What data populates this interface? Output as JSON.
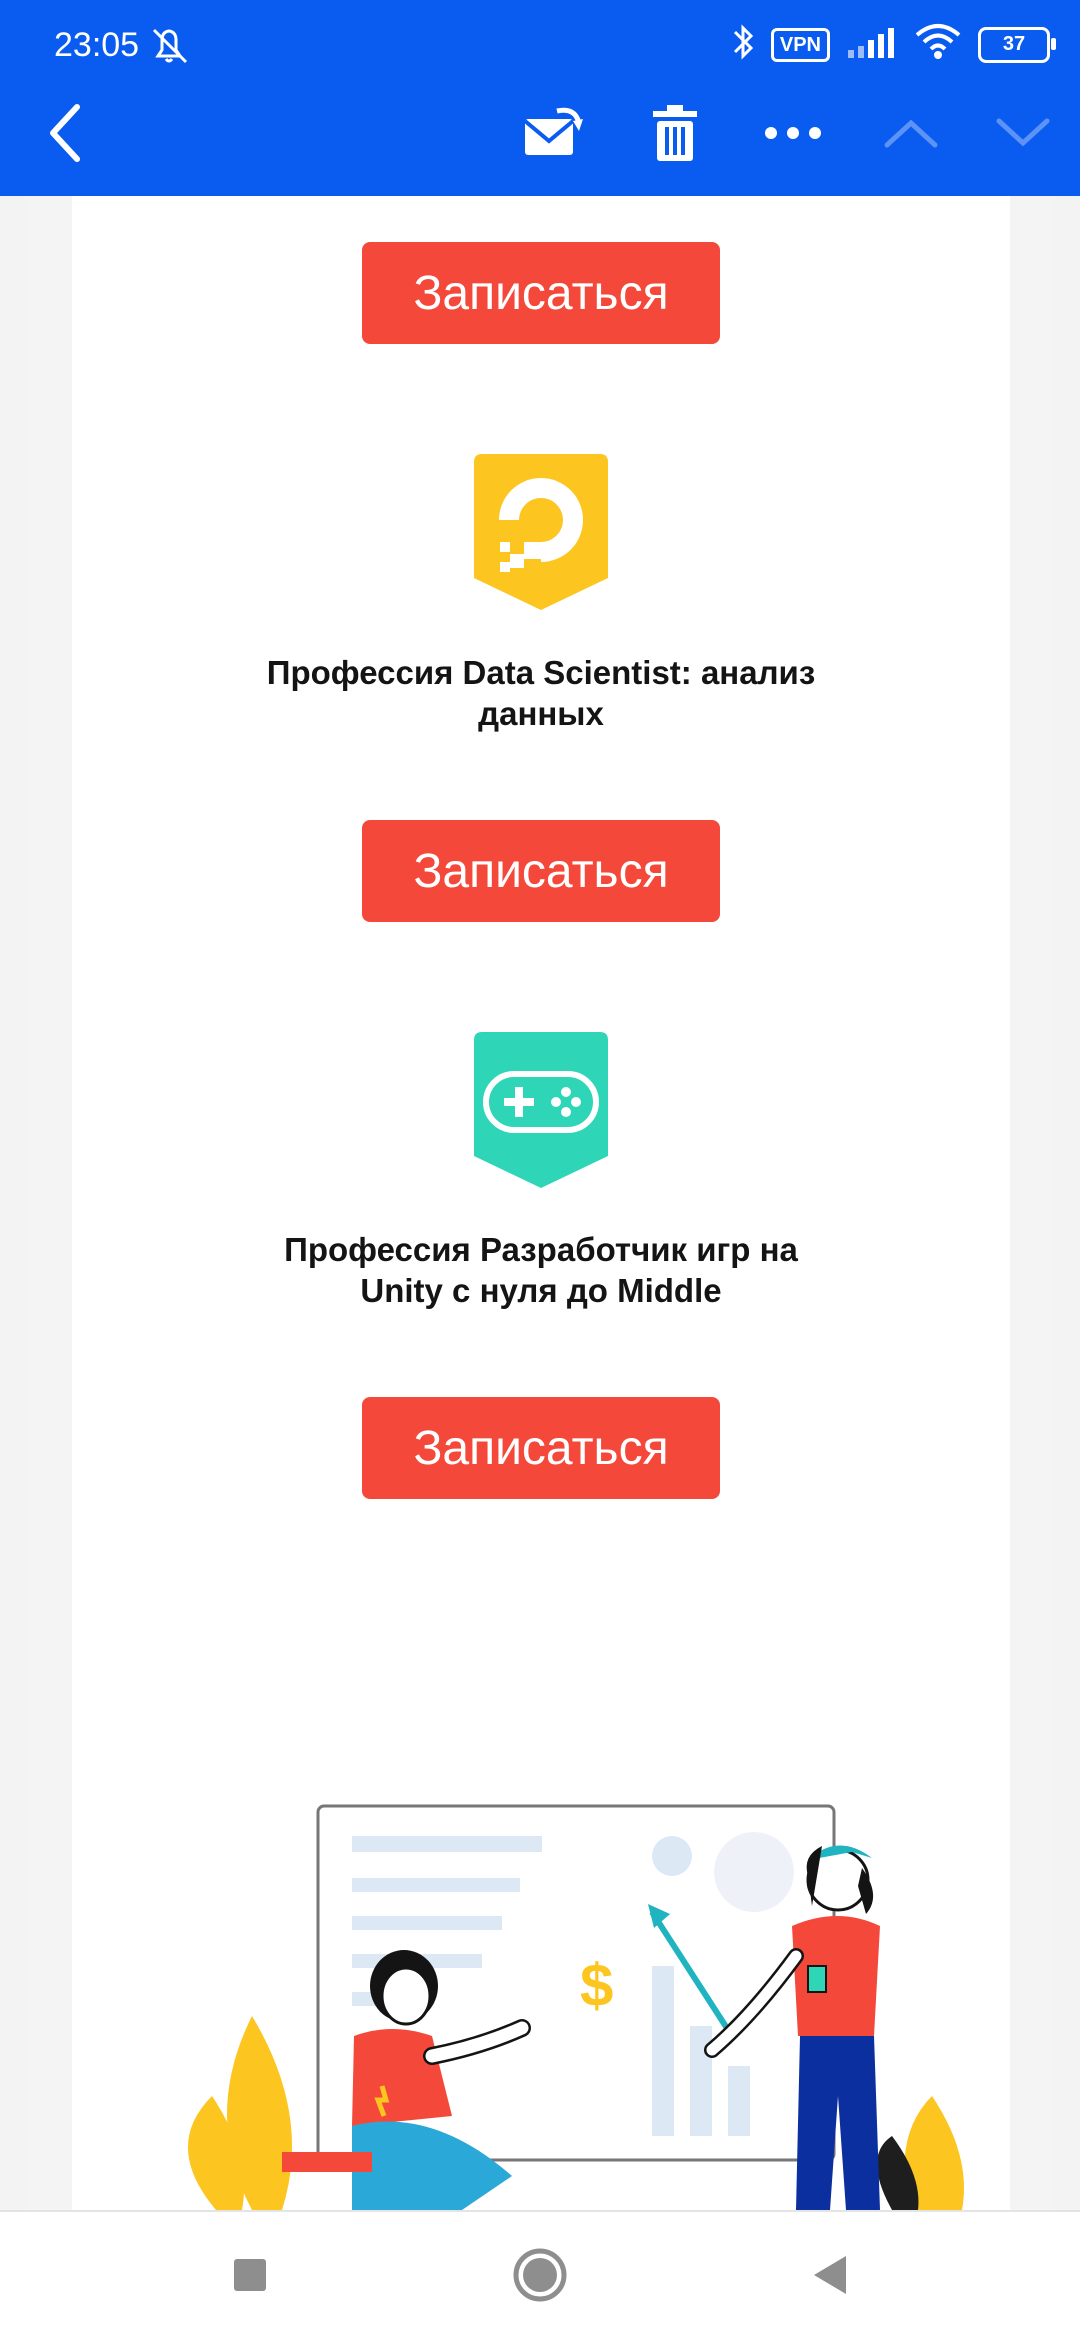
{
  "status_bar": {
    "time": "23:05",
    "vpn": "VPN",
    "battery": "37"
  },
  "toolbar": {
    "back_icon": "chevron-left-icon",
    "actions": [
      "mark-unread-icon",
      "trash-icon",
      "more-icon",
      "chevron-up-icon",
      "chevron-down-icon"
    ]
  },
  "colors": {
    "app_bar": "#0a5cf0",
    "cta": "#f4493a",
    "ds_icon": "#fcc51f",
    "game_icon": "#2ed6b7"
  },
  "courses": [
    {
      "title": "",
      "button": "Записаться"
    },
    {
      "title": "Профессия Data Scientist: анализ данных",
      "button": "Записаться",
      "icon": "digitalocean-logo-icon"
    },
    {
      "title": "Профессия Разработчик игр на Unity с нуля до Middle",
      "button": "Записаться",
      "icon": "gamepad-icon"
    }
  ],
  "illustration": {
    "symbol": "$"
  },
  "navbar": [
    "recent-apps-icon",
    "home-icon",
    "back-triangle-icon"
  ]
}
